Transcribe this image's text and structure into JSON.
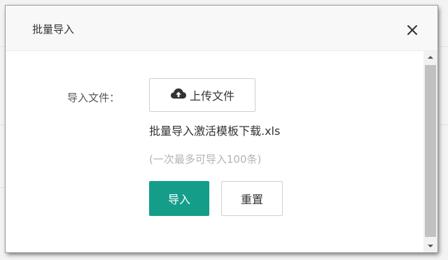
{
  "dialog": {
    "title": "批量导入",
    "close_icon": "close-icon"
  },
  "form": {
    "file_label": "导入文件：",
    "upload_icon": "cloud-upload-icon",
    "upload_label": "上传文件",
    "template_link": "批量导入激活模板下载.xls",
    "hint": "(一次最多可导入100条)",
    "import_label": "导入",
    "reset_label": "重置"
  },
  "colors": {
    "primary": "#149e8a",
    "hint_text": "#b4b4b4",
    "header_bg": "#f8f8f8",
    "border": "#cfcfcf"
  },
  "scrollbar": {
    "up_icon": "scroll-up-arrow-icon",
    "down_icon": "scroll-down-arrow-icon"
  }
}
